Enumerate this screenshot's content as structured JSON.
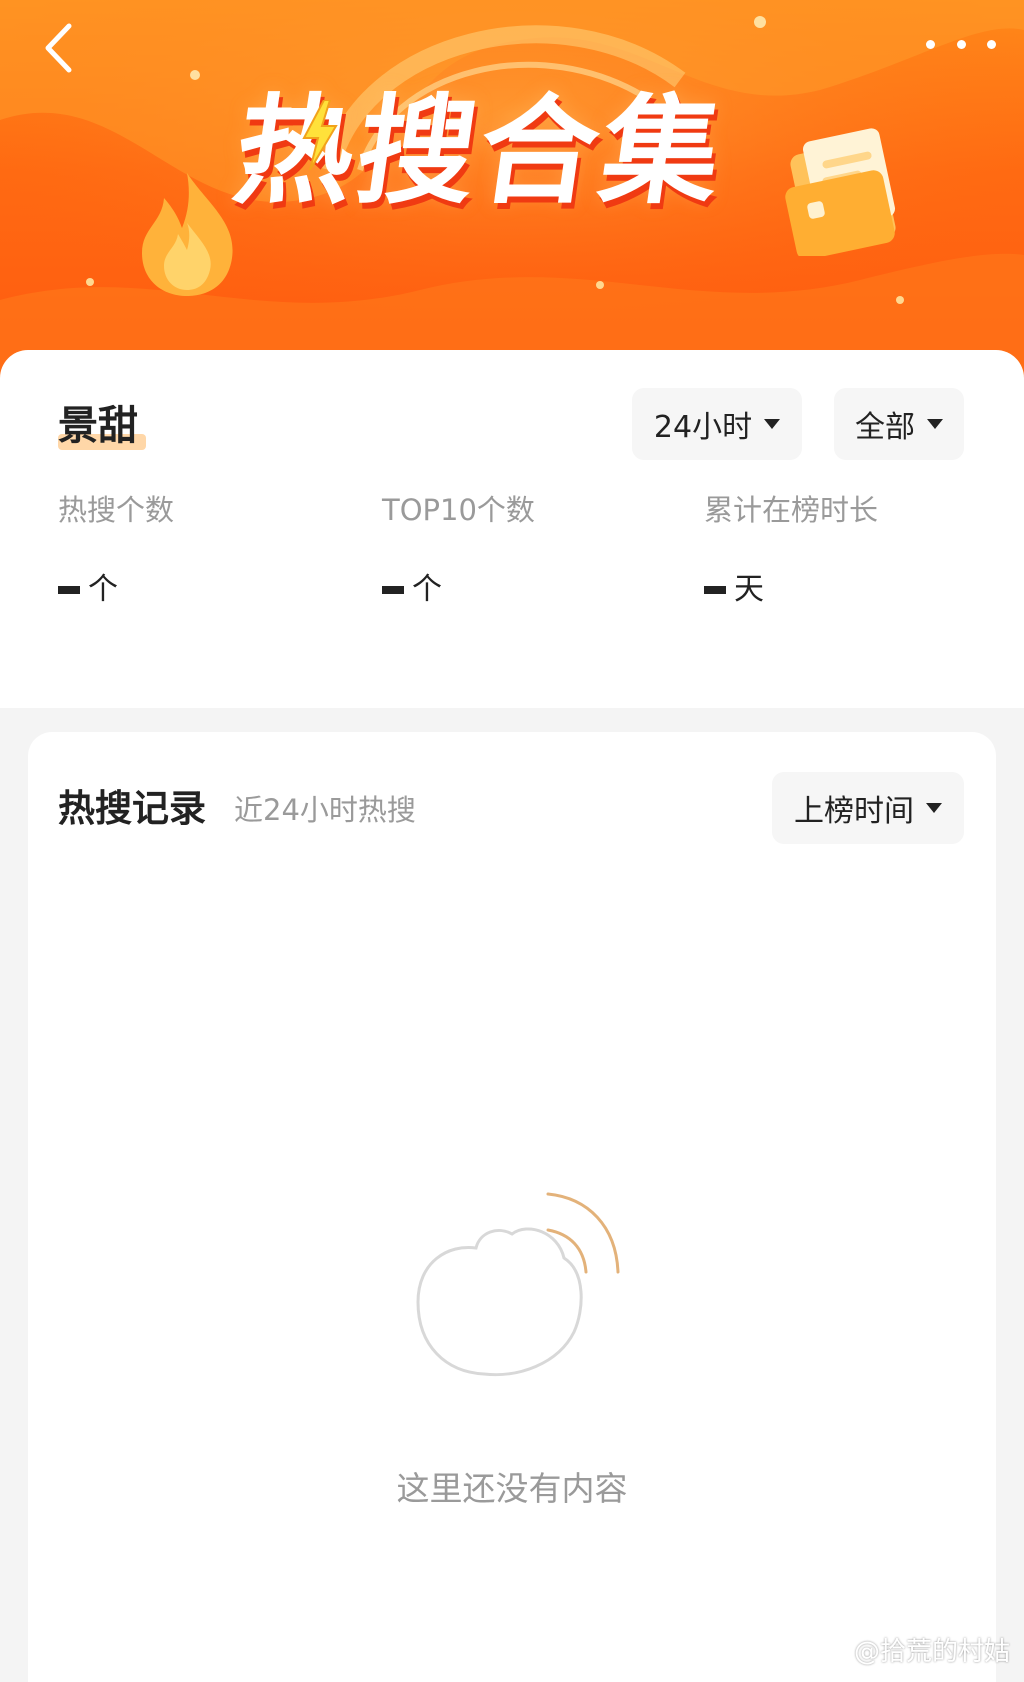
{
  "banner": {
    "title": "热搜合集",
    "colors": {
      "top": "#ff8a1a",
      "bottom": "#ff5a10"
    }
  },
  "summary": {
    "name": "景甜",
    "time_filter": "24小时",
    "scope_filter": "全部",
    "stats": [
      {
        "label": "热搜个数",
        "unit": "个"
      },
      {
        "label": "TOP10个数",
        "unit": "个"
      },
      {
        "label": "累计在榜时长",
        "unit": "天"
      }
    ]
  },
  "records": {
    "title": "热搜记录",
    "subtitle": "近24小时热搜",
    "sort_label": "上榜时间",
    "empty_text": "这里还没有内容"
  },
  "watermark": {
    "text": "@拾荒的村姑"
  },
  "icons": {
    "back": "chevron-left-icon",
    "more": "more-dots-icon",
    "empty": "empty-cloud-icon"
  }
}
